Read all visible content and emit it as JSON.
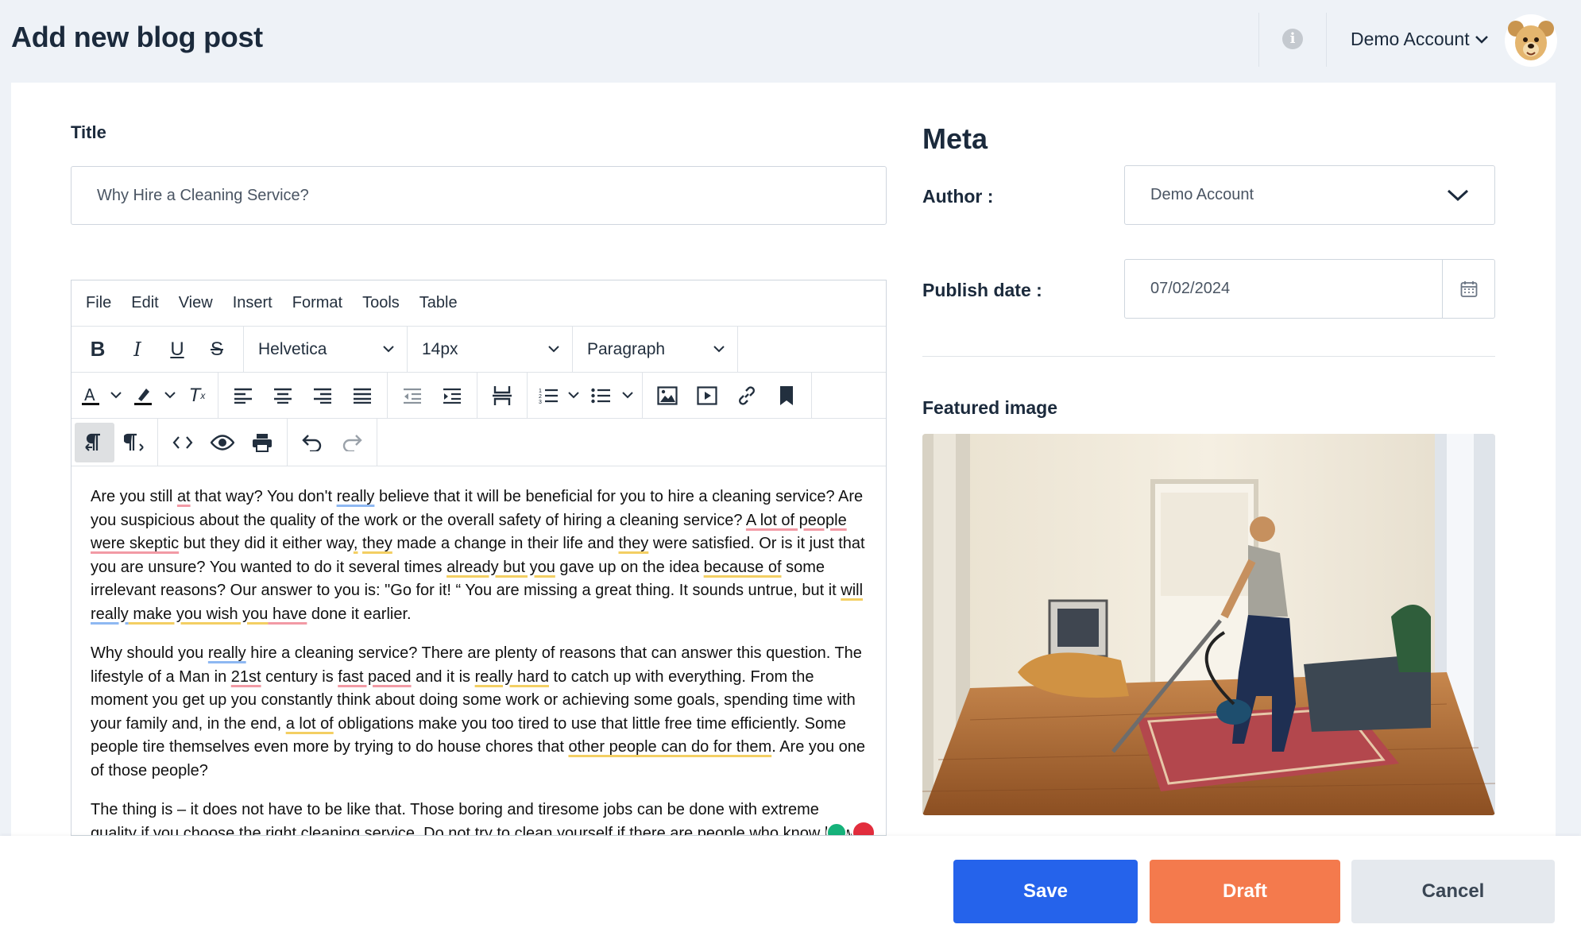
{
  "header": {
    "title": "Add new blog post",
    "account_name": "Demo Account"
  },
  "form": {
    "title_label": "Title",
    "title_value": "Why Hire a Cleaning Service?"
  },
  "editor": {
    "menu": [
      "File",
      "Edit",
      "View",
      "Insert",
      "Format",
      "Tools",
      "Table"
    ],
    "font_family": "Helvetica",
    "font_size": "14px",
    "block_format": "Paragraph",
    "paragraphs": [
      [
        {
          "t": "Are you still "
        },
        {
          "t": "at",
          "u": "red"
        },
        {
          "t": " that way? You don't "
        },
        {
          "t": "really",
          "u": "blue"
        },
        {
          "t": " believe that it will be beneficial for you to hire a cleaning service? Are you suspicious about the quality of the work or the overall safety of hiring a cleaning service? "
        },
        {
          "t": "A lot of people were skeptic",
          "u": "red"
        },
        {
          "t": " but they did it either way"
        },
        {
          "t": ",",
          "u": "yel"
        },
        {
          "t": " "
        },
        {
          "t": "they",
          "u": "yel"
        },
        {
          "t": " made a change in their life and "
        },
        {
          "t": "they",
          "u": "yel"
        },
        {
          "t": " were satisfied. Or is it just that you are unsure? You wanted to do it several times "
        },
        {
          "t": "already but you",
          "u": "yel"
        },
        {
          "t": " gave up on the idea "
        },
        {
          "t": "because of",
          "u": "yel"
        },
        {
          "t": " some irrelevant reasons? Our answer to you is: \"Go for it! “ You are missing a great thing. It sounds untrue, but it "
        },
        {
          "t": "will ",
          "u": "yel"
        },
        {
          "t": "really",
          "u": "blue"
        },
        {
          "t": " make you wish you",
          "u": "yel"
        },
        {
          "t": " have",
          "u": "red"
        },
        {
          "t": " done it earlier."
        }
      ],
      [
        {
          "t": "Why should you "
        },
        {
          "t": "really",
          "u": "blue"
        },
        {
          "t": " hire a cleaning service? There are plenty of reasons that can answer this question. The lifestyle of a Man in "
        },
        {
          "t": "21st",
          "u": "red"
        },
        {
          "t": " century is "
        },
        {
          "t": "fast paced",
          "u": "red"
        },
        {
          "t": " and it is "
        },
        {
          "t": "really hard",
          "u": "yel"
        },
        {
          "t": " to catch up with everything. From the moment you get up you constantly think about doing some work or achieving some goals, spending time with your family and, in the end, "
        },
        {
          "t": "a lot of",
          "u": "yel"
        },
        {
          "t": " obligations make you too tired to use that little free time efficiently. Some people tire themselves even more by trying to do house chores that "
        },
        {
          "t": "other people can do for them",
          "u": "yel"
        },
        {
          "t": ". Are you one of those people?"
        }
      ],
      [
        {
          "t": "The thing is – it does not have to be like that. Those boring and tiresome jobs can be done with extreme quality if you choose the right cleaning service. Do not try to clean yourself if there are people who know how to do it better."
        }
      ]
    ]
  },
  "meta": {
    "heading": "Meta",
    "author_label": "Author :",
    "author_value": "Demo Account",
    "date_label": "Publish date :",
    "date_value": "07/02/2024",
    "featured_label": "Featured image"
  },
  "actions": {
    "save": "Save",
    "draft": "Draft",
    "cancel": "Cancel"
  },
  "colors": {
    "save": "#2563eb",
    "draft": "#f47a4d",
    "cancel": "#e5e9ee"
  }
}
